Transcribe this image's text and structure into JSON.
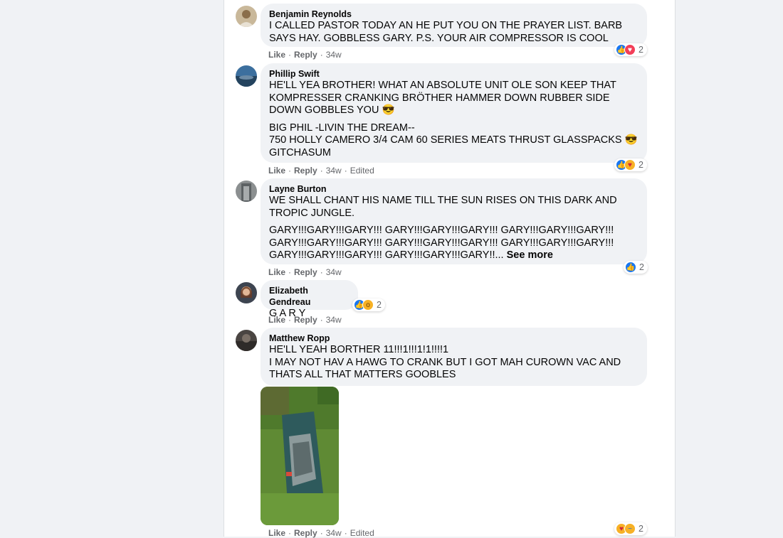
{
  "comments": [
    {
      "author": "Benjamin Reynolds",
      "paragraphs": [
        "I CALLED PASTOR TODAY AN HE PUT YOU ON THE PRAYER LIST. BARB SAYS HAY. GOBBLESS GARY. P.S. YOUR AIR COMPRESSOR IS COOL"
      ],
      "actions": {
        "like": "Like",
        "reply": "Reply",
        "time": "34w"
      },
      "reactions": {
        "icons": [
          "like",
          "love"
        ],
        "count": "2"
      }
    },
    {
      "author": "Phillip Swift",
      "paragraphs": [
        "HE'LL YEA BROTHER! WHAT AN ABSOLUTE UNIT OLE SON KEEP THAT KOMPRESSER CRANKING BRÖTHER HAMMER DOWN RUBBER SIDE DOWN GOBBLES YOU 😎",
        "BIG PHIL -LIVIN THE DREAM--\n750 HOLLY CAMERO 3/4 CAM 60 SERIES MEATS THRUST GLASSPACKS 😎 GITCHASUM"
      ],
      "actions": {
        "like": "Like",
        "reply": "Reply",
        "time": "34w",
        "edited": "Edited"
      },
      "reactions": {
        "icons": [
          "like",
          "care"
        ],
        "count": "2"
      }
    },
    {
      "author": "Layne Burton",
      "paragraphs": [
        "WE SHALL CHANT HIS NAME TILL THE SUN RISES ON THIS DARK AND TROPIC JUNGLE.",
        "GARY!!!GARY!!!GARY!!! GARY!!!GARY!!!GARY!!! GARY!!!GARY!!!GARY!!! GARY!!!GARY!!!GARY!!! GARY!!!GARY!!!GARY!!! GARY!!!GARY!!!GARY!!! GARY!!!GARY!!!GARY!!! GARY!!!GARY!!!GARY!!..."
      ],
      "see_more": "See more",
      "actions": {
        "like": "Like",
        "reply": "Reply",
        "time": "34w"
      },
      "reactions": {
        "icons": [
          "like"
        ],
        "count": "2"
      }
    },
    {
      "author": "Elizabeth Gendreau",
      "paragraphs": [
        "G A R Y"
      ],
      "actions": {
        "like": "Like",
        "reply": "Reply",
        "time": "34w"
      },
      "reactions": {
        "icons": [
          "like",
          "wow"
        ],
        "count": "2"
      }
    },
    {
      "author": "Matthew Ropp",
      "paragraphs": [
        "HE'LL YEAH BORTHER 11!!!1!!!1!1!!!!1\nI MAY NOT HAV A HAWG TO CRANK BUT I GOT MAH CUROWN VAC AND THATS ALL THAT MATTERS GOOBLES"
      ],
      "actions": {
        "like": "Like",
        "reply": "Reply",
        "time": "34w",
        "edited": "Edited"
      },
      "reactions": {
        "icons": [
          "care",
          "sad"
        ],
        "count": "2"
      }
    }
  ],
  "colors": {
    "bubble": "#f0f2f5",
    "like": "#1877f2",
    "love": "#f33e58",
    "muted": "#65676b"
  }
}
